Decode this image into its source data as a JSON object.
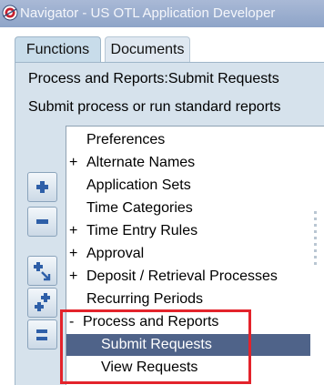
{
  "window": {
    "title": "Navigator - US OTL Application Developer",
    "app_icon": "oracle-logo-icon"
  },
  "tabs": [
    {
      "label": "Functions",
      "active": true
    },
    {
      "label": "Documents",
      "active": false
    }
  ],
  "context": {
    "path": "Process and Reports:Submit Requests",
    "description": "Submit process or run standard reports"
  },
  "tree": {
    "items": [
      {
        "prefix": "",
        "label": "Preferences",
        "state": "leaf"
      },
      {
        "prefix": "+",
        "label": "Alternate Names",
        "state": "collapsed"
      },
      {
        "prefix": "",
        "label": "Application Sets",
        "state": "leaf"
      },
      {
        "prefix": "",
        "label": "Time Categories",
        "state": "leaf"
      },
      {
        "prefix": "+",
        "label": "Time Entry Rules",
        "state": "collapsed"
      },
      {
        "prefix": "+",
        "label": "Approval",
        "state": "collapsed"
      },
      {
        "prefix": "+",
        "label": "Deposit / Retrieval Processes",
        "state": "collapsed"
      },
      {
        "prefix": "",
        "label": "Recurring Periods",
        "state": "leaf"
      },
      {
        "prefix": "-",
        "label": "Process and Reports",
        "state": "expanded"
      },
      {
        "prefix": "",
        "label": "Submit Requests",
        "state": "selected"
      },
      {
        "prefix": "",
        "label": "View Requests",
        "state": "leaf"
      }
    ]
  },
  "side_buttons": [
    {
      "icon": "expand-plus-icon"
    },
    {
      "icon": "collapse-minus-icon"
    },
    {
      "icon": "expand-branch-icon"
    },
    {
      "icon": "expand-all-icon"
    },
    {
      "icon": "collapse-all-icon"
    }
  ],
  "colors": {
    "selection": "#4f6389",
    "panel": "#d6e2ec",
    "highlight": "#e3232b"
  }
}
